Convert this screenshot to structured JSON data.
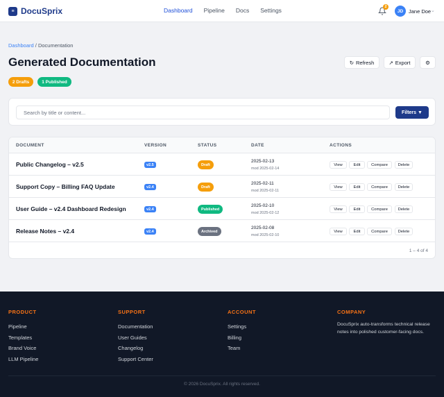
{
  "app": {
    "logo_glyph": "≡",
    "name": "DocuSprix",
    "brand_color": "#1e3a8a",
    "accent_color": "#3b82f6"
  },
  "nav": [
    {
      "label": "Dashboard",
      "active": true
    },
    {
      "label": "Pipeline",
      "active": false
    },
    {
      "label": "Docs",
      "active": false
    },
    {
      "label": "Settings",
      "active": false
    }
  ],
  "header": {
    "notification_count": "2",
    "user_initials": "JD",
    "user_name": "Jane Doe",
    "icons": [
      "bell-icon",
      "chevron-down-icon"
    ]
  },
  "breadcrumb": {
    "root": "Dashboard",
    "separator": " / ",
    "current": "Documentation"
  },
  "page": {
    "title": "Generated Documentation",
    "refresh_label": "Refresh",
    "export_label": "Export",
    "drafts_badge": "2 Drafts",
    "published_badge": "1 Published"
  },
  "search": {
    "placeholder": "Search by title or content...",
    "value": "",
    "filters_label": "Filters ▼"
  },
  "table": {
    "columns": [
      "DOCUMENT",
      "VERSION",
      "STATUS",
      "DATE",
      "ACTIONS"
    ],
    "rows": [
      {
        "title": "Public Changelog – v2.5",
        "version": "v2.5",
        "status": "Draft",
        "status_color": "#f59e0b",
        "date": "2025-02-13",
        "modified": "mod 2025-02-14"
      },
      {
        "title": "Support Copy – Billing FAQ Update",
        "version": "v2.4",
        "status": "Draft",
        "status_color": "#f59e0b",
        "date": "2025-02-11",
        "modified": "mod 2025-02-11"
      },
      {
        "title": "User Guide – v2.4 Dashboard Redesign",
        "version": "v2.4",
        "status": "Published",
        "status_color": "#10b981",
        "date": "2025-02-10",
        "modified": "mod 2025-02-12"
      },
      {
        "title": "Release Notes – v2.4",
        "version": "v2.4",
        "status": "Archived",
        "status_color": "#6b7280",
        "date": "2025-02-08",
        "modified": "mod 2025-02-10"
      }
    ],
    "actions": [
      "View",
      "Edit",
      "Compare",
      "Delete"
    ],
    "pagination": "1 – 4 of 4"
  },
  "footer": {
    "columns": [
      {
        "heading": "PRODUCT",
        "links": [
          "Pipeline",
          "Templates",
          "Brand Voice",
          "LLM Pipeline"
        ]
      },
      {
        "heading": "SUPPORT",
        "links": [
          "Documentation",
          "User Guides",
          "Changelog",
          "Support Center"
        ]
      },
      {
        "heading": "ACCOUNT",
        "links": [
          "Settings",
          "Billing",
          "Team"
        ]
      },
      {
        "heading": "COMPANY",
        "description": "DocuSprix auto-transforms technical release notes into polished customer-facing docs."
      }
    ],
    "copyright": "© 2026 DocuSprix. All rights reserved."
  }
}
